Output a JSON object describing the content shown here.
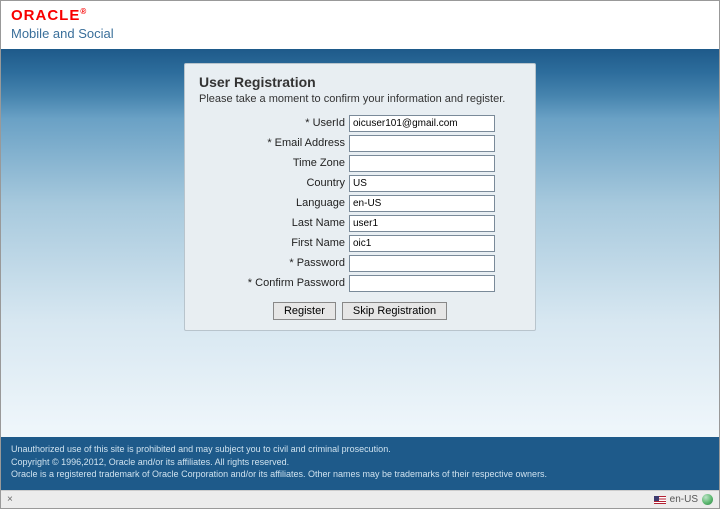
{
  "header": {
    "brand": "ORACLE",
    "brand_sup": "®",
    "product": "Mobile and Social"
  },
  "panel": {
    "title": "User Registration",
    "instruction": "Please take a moment to confirm your information and register."
  },
  "fields": {
    "userid": {
      "label": "* UserId",
      "value": "oicuser101@gmail.com"
    },
    "email": {
      "label": "* Email Address",
      "value": ""
    },
    "timezone": {
      "label": "Time Zone",
      "value": ""
    },
    "country": {
      "label": "Country",
      "value": "US"
    },
    "language": {
      "label": "Language",
      "value": "en-US"
    },
    "lastname": {
      "label": "Last Name",
      "value": "user1"
    },
    "firstname": {
      "label": "First Name",
      "value": "oic1"
    },
    "password": {
      "label": "* Password",
      "value": ""
    },
    "confirm": {
      "label": "* Confirm Password",
      "value": ""
    }
  },
  "buttons": {
    "register": "Register",
    "skip": "Skip Registration"
  },
  "footer": {
    "line1": "Unauthorized use of this site is prohibited and may subject you to civil and criminal prosecution.",
    "line2": "Copyright © 1996,2012, Oracle and/or its affiliates. All rights reserved.",
    "line3": "Oracle is a registered trademark of Oracle Corporation and/or its affiliates. Other names may be trademarks of their respective owners."
  },
  "statusbar": {
    "close": "×",
    "locale": "en-US"
  }
}
